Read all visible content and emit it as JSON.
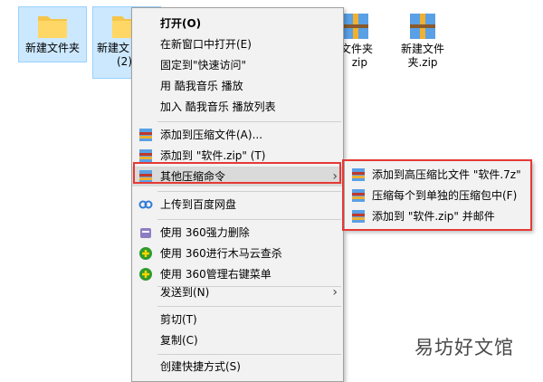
{
  "files": [
    {
      "name": "新建文件夹",
      "icon": "folder-icon"
    },
    {
      "name": "新建文件夹 (2)",
      "icon": "folder-icon"
    },
    {
      "name": "文件夹.zip",
      "icon": "zip-archive-icon"
    },
    {
      "name": "新建文件夹.zip",
      "icon": "zip-archive-icon"
    }
  ],
  "file_labels": {
    "f1": "新建文件夹",
    "f2_line1": "新建文",
    "f2_line2": "(2)",
    "f3_line1": "文件夹",
    "f3_line2": "zip",
    "f4_line1": "新建文件",
    "f4_line2": "夹.zip"
  },
  "context_menu": {
    "open": "打开(O)",
    "open_new_window": "在新窗口中打开(E)",
    "pin_quick_access": "固定到\"快速访问\"",
    "kuwo_play": "用 酷我音乐 播放",
    "kuwo_add_playlist": "加入 酷我音乐 播放列表",
    "add_to_archive": "添加到压缩文件(A)...",
    "add_to_zip": "添加到 \"软件.zip\" (T)",
    "other_compress": "其他压缩命令",
    "upload_baidu": "上传到百度网盘",
    "del_360": "使用 360强力删除",
    "scan_360": "使用 360进行木马云查杀",
    "manage_360": "使用 360管理右键菜单",
    "send_to": "发送到(N)",
    "cut": "剪切(T)",
    "copy": "复制(C)",
    "create_shortcut": "创建快捷方式(S)"
  },
  "submenu": {
    "add_7z": "添加到高压缩比文件 \"软件.7z\"",
    "compress_each": "压缩每个到单独的压缩包中(F)",
    "add_zip_email": "添加到 \"软件.zip\" 并邮件"
  },
  "watermark": "易坊好文馆",
  "colors": {
    "highlight_border": "#e53935",
    "selection_bg": "#cce8ff",
    "menu_bg": "#f2f2f2"
  }
}
